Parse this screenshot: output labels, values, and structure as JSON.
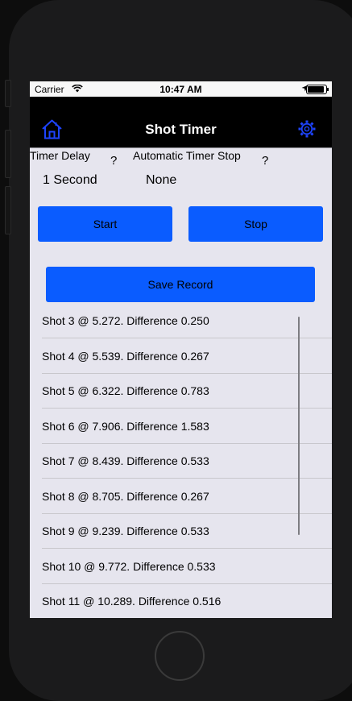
{
  "status_bar": {
    "carrier": "Carrier",
    "time": "10:47 AM",
    "battery_level": 0.9
  },
  "nav": {
    "title": "Shot Timer",
    "home_icon": "home-icon",
    "settings_icon": "gear-icon",
    "icon_color": "#1e44ff"
  },
  "settings": {
    "timer_delay_label": "Timer Delay",
    "timer_delay_help": "?",
    "timer_delay_value": "1 Second",
    "auto_stop_label": "Automatic Timer Stop",
    "auto_stop_help": "?",
    "auto_stop_value": "None"
  },
  "buttons": {
    "start": "Start",
    "stop": "Stop",
    "save": "Save Record",
    "color": "#0a5cff"
  },
  "shots": [
    "Shot 3 @ 5.272. Difference 0.250",
    "Shot 4 @ 5.539. Difference 0.267",
    "Shot 5 @ 6.322. Difference 0.783",
    "Shot 6 @ 7.906. Difference 1.583",
    "Shot 7 @ 8.439. Difference 0.533",
    "Shot 8 @ 8.705. Difference 0.267",
    "Shot 9 @ 9.239. Difference 0.533",
    "Shot 10 @ 9.772. Difference 0.533",
    "Shot 11 @ 10.289. Difference 0.516"
  ]
}
